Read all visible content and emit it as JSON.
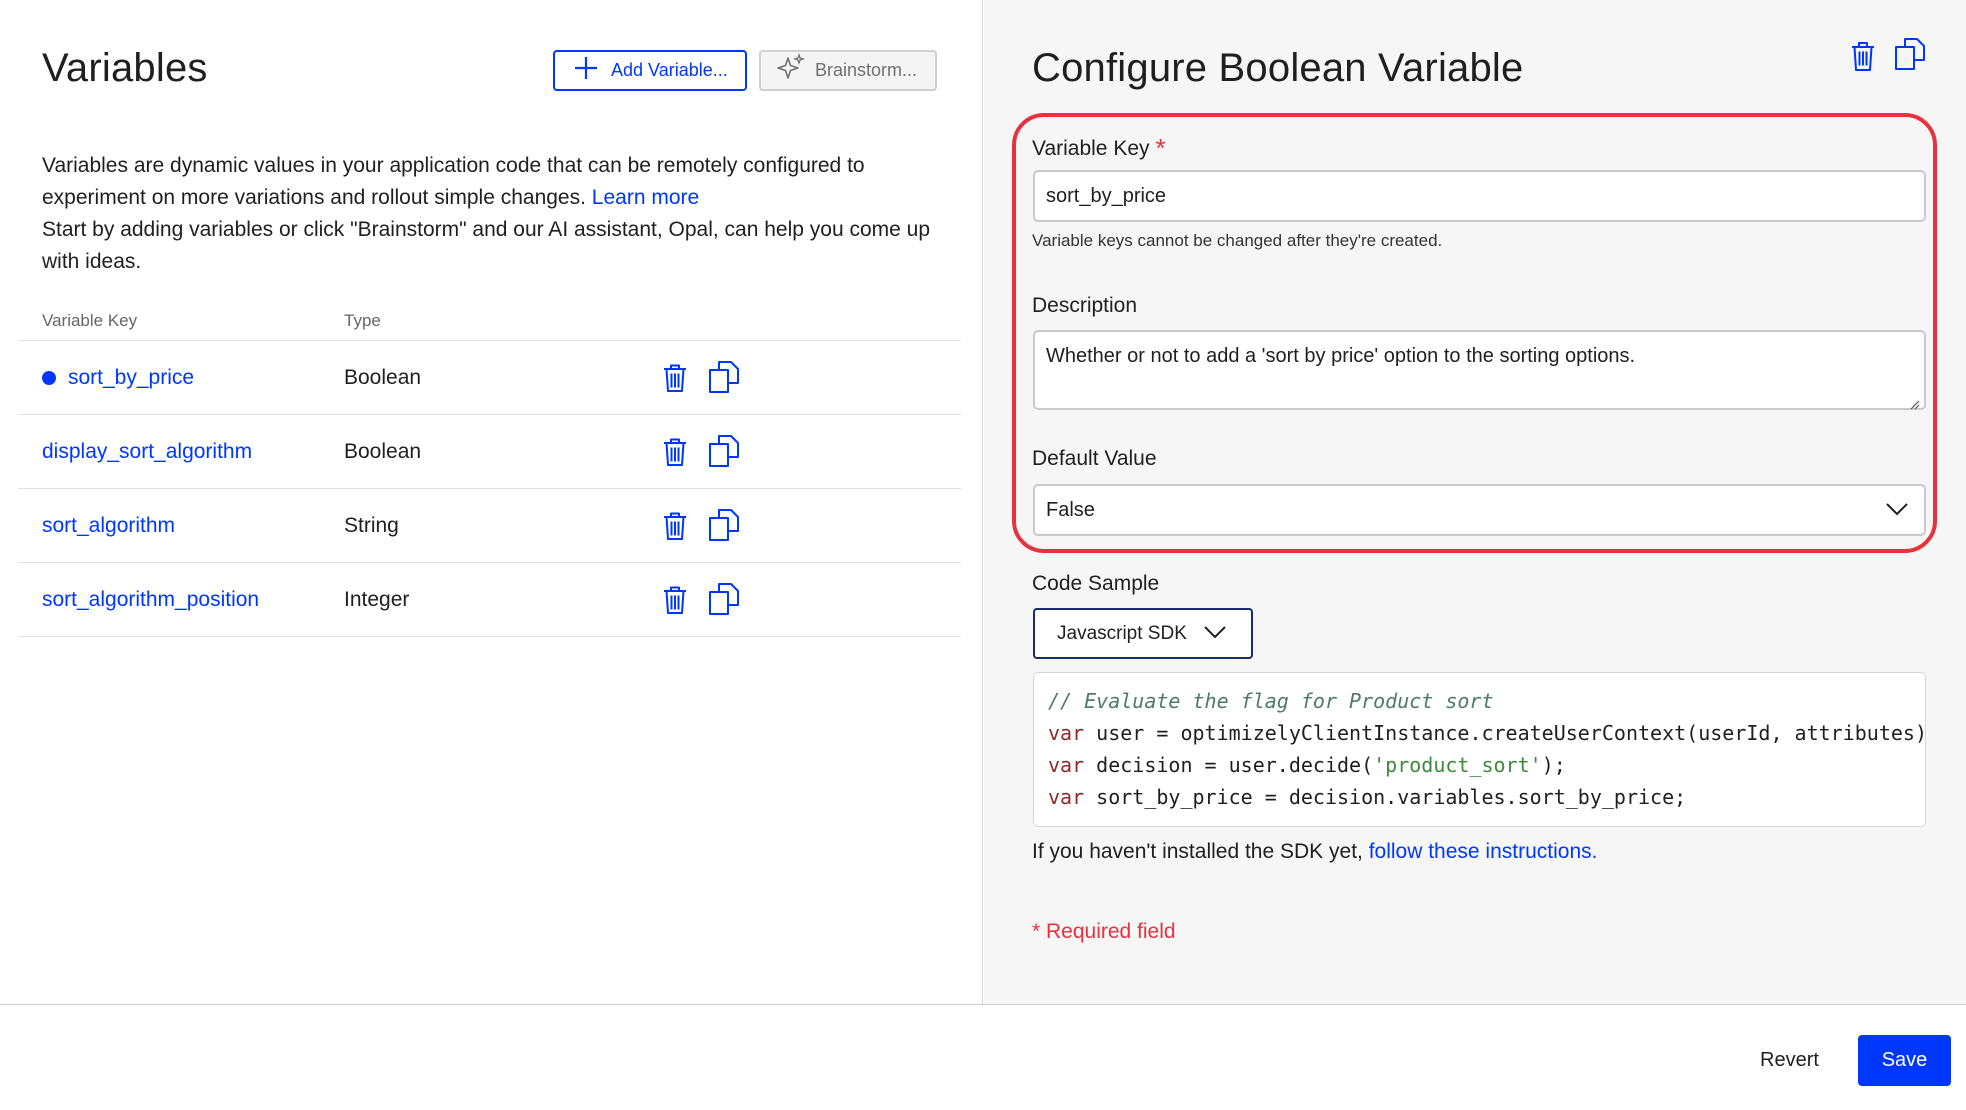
{
  "left": {
    "title": "Variables",
    "add_button": "Add Variable...",
    "brainstorm_button": "Brainstorm...",
    "intro_line1": "Variables are dynamic values in your application code that can be remotely configured to experiment on more variations and rollout simple changes. ",
    "learn_more": "Learn more",
    "intro_line2": "Start by adding variables or click \"Brainstorm\" and our AI assistant, Opal, can help you come up with ideas.",
    "table": {
      "headers": [
        "Variable Key",
        "Type"
      ],
      "rows": [
        {
          "key": "sort_by_price",
          "type": "Boolean",
          "selected": true
        },
        {
          "key": "display_sort_algorithm",
          "type": "Boolean",
          "selected": false
        },
        {
          "key": "sort_algorithm",
          "type": "String",
          "selected": false
        },
        {
          "key": "sort_algorithm_position",
          "type": "Integer",
          "selected": false
        }
      ]
    }
  },
  "right": {
    "title": "Configure Boolean Variable",
    "variable_key_label": "Variable Key",
    "required_star": "*",
    "variable_key_value": "sort_by_price",
    "variable_key_hint": "Variable keys cannot be changed after they're created.",
    "description_label": "Description",
    "description_value": "Whether or not to add a 'sort by price' option to the sorting options.",
    "default_value_label": "Default Value",
    "default_value": "False",
    "code_sample_label": "Code Sample",
    "sdk_select": "Javascript SDK",
    "code": {
      "comment": "// Evaluate the flag for Product sort",
      "line2_kw": "var",
      "line2_rest": " user = optimizelyClientInstance.createUserContext(userId, attributes);",
      "line3_kw": "var",
      "line3_mid": " decision = user.decide(",
      "line3_str": "'product_sort'",
      "line3_end": ");",
      "line4_kw": "var",
      "line4_rest": " sort_by_price = decision.variables.sort_by_price;"
    },
    "install_text": "If you haven't installed the SDK yet, ",
    "install_link": "follow these instructions.",
    "required_note": "* Required field"
  },
  "footer": {
    "revert": "Revert",
    "save": "Save"
  },
  "colors": {
    "accent": "#0037ff",
    "highlight": "#e5323d",
    "panel_bg": "#f6f6f6"
  },
  "icons": [
    "plus-icon",
    "sparkle-icon",
    "trash-icon",
    "copy-icon",
    "chevron-down-icon",
    "resize-grip-icon"
  ]
}
